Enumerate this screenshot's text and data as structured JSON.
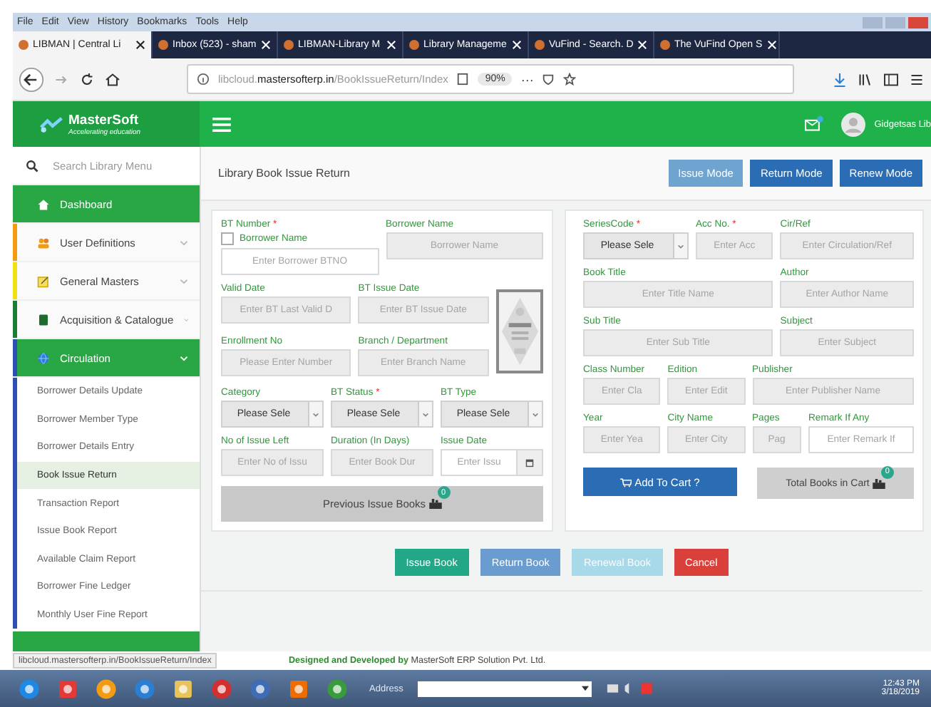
{
  "menu_bar": [
    "File",
    "Edit",
    "View",
    "History",
    "Bookmarks",
    "Tools",
    "Help"
  ],
  "browser_tabs": [
    {
      "title": "LIBMAN | Central Li",
      "selected": true
    },
    {
      "title": "Inbox (523) - sham",
      "selected": false
    },
    {
      "title": "LIBMAN-Library M",
      "selected": false
    },
    {
      "title": "Library Manageme",
      "selected": false
    },
    {
      "title": "VuFind - Search. D",
      "selected": false
    },
    {
      "title": "The VuFind Open S",
      "selected": false
    }
  ],
  "address_bar": {
    "url_host": "libcloud.",
    "url_domain": "mastersofterp.in",
    "url_path": "/BookIssueReturn/Index",
    "zoom": "90%",
    "more": "···"
  },
  "app_header": {
    "logo_title": "MasterSoft",
    "logo_tagline": "Accelerating education",
    "user": "Gidgetsas Lib"
  },
  "sidebar": {
    "search_placeholder": "Search Library Menu",
    "items": [
      {
        "kind": "link",
        "label": "Dashboard",
        "selected": true
      },
      {
        "kind": "group",
        "label": "User Definitions",
        "expanded": false,
        "color": "#f39c12"
      },
      {
        "kind": "group",
        "label": "General Masters",
        "expanded": false,
        "color": "#f1e20f"
      },
      {
        "kind": "group",
        "label": "Acquisition & Catalogue",
        "expanded": false,
        "color": "#1e7d34"
      },
      {
        "kind": "group",
        "label": "Circulation",
        "expanded": true,
        "color": "#2f4fb0",
        "children": [
          {
            "label": "Borrower Details Update",
            "selected": false
          },
          {
            "label": "Borrower Member Type",
            "selected": false
          },
          {
            "label": "Borrower Details Entry",
            "selected": false
          },
          {
            "label": "Book Issue Return",
            "selected": true
          },
          {
            "label": "Transaction Report",
            "selected": false
          },
          {
            "label": "Issue Book Report",
            "selected": false
          },
          {
            "label": "Available Claim Report",
            "selected": false
          },
          {
            "label": "Borrower Fine Ledger",
            "selected": false
          },
          {
            "label": "Monthly User Fine Report",
            "selected": false
          }
        ]
      }
    ]
  },
  "page_title": "Library Book Issue Return",
  "mode_buttons": [
    {
      "label": "Issue Mode",
      "selected": true
    },
    {
      "label": "Return Mode",
      "selected": false
    },
    {
      "label": "Renew Mode",
      "selected": false
    }
  ],
  "borrower_form": {
    "rows": [
      [
        {
          "kind": "checkbox_text",
          "label": "BT Number",
          "required_mark": "*",
          "checkbox": {
            "label": "Borrower Name",
            "checked": false
          },
          "placeholder": "Enter Borrower BTNO",
          "disabled": false
        },
        {
          "kind": "text",
          "label": "Borrower Name",
          "placeholder": "Borrower Name",
          "disabled": true
        }
      ],
      [
        {
          "kind": "text",
          "label": "Valid Date",
          "placeholder": "Enter BT Last Valid D",
          "disabled": true
        },
        {
          "kind": "text",
          "label": "BT Issue Date",
          "placeholder": "Enter BT Issue Date",
          "disabled": true
        }
      ],
      [
        {
          "kind": "text",
          "label": "Enrollment No",
          "placeholder": "Please Enter Number",
          "disabled": true
        },
        {
          "kind": "text",
          "label": "Branch / Department",
          "placeholder": "Enter Branch Name",
          "disabled": true
        }
      ],
      [
        {
          "kind": "select",
          "label": "Category",
          "value": "Please Sele"
        },
        {
          "kind": "select",
          "label": "BT Status",
          "required_mark": "*",
          "value": "Please Sele"
        },
        {
          "kind": "select",
          "label": "BT Type",
          "value": "Please Sele"
        }
      ],
      [
        {
          "kind": "text",
          "label": "No of Issue Left",
          "placeholder": "Enter No of Issu",
          "disabled": true
        },
        {
          "kind": "text",
          "label": "Duration (In Days)",
          "placeholder": "Enter Book Dur",
          "disabled": true
        },
        {
          "kind": "date",
          "label": "Issue Date",
          "placeholder": "Enter Issu",
          "disabled": false
        }
      ]
    ],
    "photo": {
      "kind": "picture"
    },
    "history_button": {
      "label": "Previous Issue Books",
      "badge": "0"
    }
  },
  "book_form": {
    "rows": [
      [
        {
          "kind": "select",
          "label": "SeriesCode",
          "required_mark": "*",
          "value": "Please Sele"
        },
        {
          "kind": "text",
          "label": "Acc No.",
          "required_mark": "*",
          "placeholder": "Enter Acc",
          "disabled": true
        },
        {
          "kind": "text",
          "label": "Cir/Ref",
          "placeholder": "Enter Circulation/Ref",
          "disabled": true
        }
      ],
      [
        {
          "kind": "text",
          "label": "Book Title",
          "placeholder": "Enter Title Name",
          "disabled": true
        },
        {
          "kind": "text",
          "label": "Author",
          "placeholder": "Enter Author Name",
          "disabled": true
        }
      ],
      [
        {
          "kind": "text",
          "label": "Sub Title",
          "placeholder": "Enter Sub Title",
          "disabled": true
        },
        {
          "kind": "text",
          "label": "Subject",
          "placeholder": "Enter Subject",
          "disabled": true
        }
      ],
      [
        {
          "kind": "text",
          "label": "Class Number",
          "placeholder": "Enter Cla",
          "disabled": true
        },
        {
          "kind": "text",
          "label": "Edition",
          "placeholder": "Enter Edit",
          "disabled": true
        },
        {
          "kind": "text",
          "label": "Publisher",
          "placeholder": "Enter Publisher Name",
          "disabled": true
        }
      ],
      [
        {
          "kind": "text",
          "label": "Year",
          "placeholder": "Enter Yea",
          "disabled": true
        },
        {
          "kind": "text",
          "label": "City Name",
          "placeholder": "Enter City",
          "disabled": true
        },
        {
          "kind": "text",
          "label": "Pages",
          "placeholder": "Pag",
          "disabled": true
        },
        {
          "kind": "text",
          "label": "Remark If Any",
          "placeholder": "Enter Remark If",
          "disabled": false
        }
      ]
    ],
    "cart_button": {
      "label": "Add To Cart ?"
    },
    "cart_total": {
      "label": "Total Books in Cart",
      "badge": "0"
    }
  },
  "action_buttons": [
    {
      "kind": "issue",
      "label": "Issue Book",
      "disabled": false
    },
    {
      "kind": "return",
      "label": "Return Book",
      "disabled": false
    },
    {
      "kind": "renew",
      "label": "Renewal Book",
      "disabled": true
    },
    {
      "kind": "cancel",
      "label": "Cancel",
      "disabled": false
    }
  ],
  "footer": {
    "lead": "Designed and Developed by",
    "company": "MasterSoft ERP Solution Pvt. Ltd."
  },
  "status_url": "libcloud.mastersofterp.in/BookIssueReturn/Index",
  "taskbar": {
    "address_label": "Address",
    "time": "12:43 PM",
    "date": "3/18/2019"
  }
}
